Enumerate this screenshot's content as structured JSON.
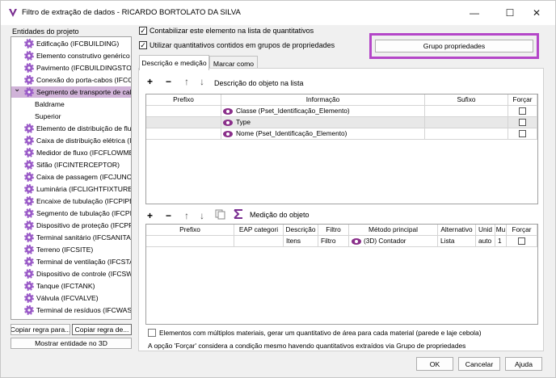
{
  "window": {
    "title": "Filtro de extração de dados - RICARDO BORTOLATO DA SILVA",
    "minimize": "—",
    "maximize": "☐",
    "close": "✕"
  },
  "left": {
    "label": "Entidades do projeto",
    "items": [
      "Edificação (IFCBUILDING)",
      "Elemento construtivo genérico (I",
      "Pavimento (IFCBUILDINGSTOREY",
      "Conexão do porta-cabos (IFCCAI",
      "Segmento de transporte de cabo",
      "Baldrame",
      "Superior",
      "Elemento de distribuição de flux",
      "Caixa de distribuição elétrica (IFC",
      "Medidor de fluxo (IFCFLOWMETI",
      "Sifão (IFCINTERCEPTOR)",
      "Caixa de passagem (IFCJUNCTIO",
      "Luminária (IFCLIGHTFIXTURE)",
      "Encaixe de tubulação (IFCPIPEFIT",
      "Segmento de tubulação (IFCPIPE",
      "Dispositivo de proteção (IFCPRO",
      "Terminal sanitário (IFCSANITARY",
      "Terreno (IFCSITE)",
      "Terminal de ventilação (IFCSTACI",
      "Dispositivo de controle (IFCSWIT",
      "Tanque (IFCTANK)",
      "Válvula (IFCVALVE)",
      "Terminal de resíduos (IFCWASTE"
    ],
    "btn_copy_para": "Copiar regra para...",
    "btn_copy_de": "Copiar regra de...",
    "btn_show_3d": "Mostrar entidade no 3D"
  },
  "options": {
    "check1": "Contabilizar este elemento na lista de quantitativos",
    "check2": "Utilizar quantitativos contidos em grupos de propriedades",
    "group_btn": "Grupo propriedades"
  },
  "tabs": [
    "Descrição e medição",
    "Marcar como"
  ],
  "desc": {
    "toolbar_label": "Descrição do objeto na lista",
    "headers": [
      "Prefixo",
      "Informação",
      "Sufixo",
      "Forçar"
    ],
    "rows": [
      {
        "info": "Classe (Pset_Identificação_Elemento)"
      },
      {
        "info": "Type"
      },
      {
        "info": "Nome (Pset_Identificação_Elemento)"
      }
    ]
  },
  "measure": {
    "toolbar_label": "Medição do objeto",
    "headers": [
      "Prefixo",
      "EAP categori",
      "Descrição",
      "Filtro",
      "Método principal",
      "Alternativo",
      "Unid",
      "Mu",
      "Forçar"
    ],
    "row": {
      "descricao": "Itens",
      "filtro": "Filtro",
      "metodo": "(3D) Contador",
      "alternativo": "Lista",
      "unid": "auto",
      "mu": "1"
    }
  },
  "footer": {
    "multi_material": "Elementos com múltiplos materiais, gerar um quantitativo de área para cada material (parede e laje cebola)",
    "note": "A opção 'Forçar' considera a condição mesmo havendo quantitativos extraídos via Grupo de propriedades",
    "ok": "OK",
    "cancel": "Cancelar",
    "help": "Ajuda"
  },
  "colors": {
    "highlight_border": "#b446c8",
    "selected_row": "#d0b3d8",
    "icon": "#9b5cc8"
  }
}
